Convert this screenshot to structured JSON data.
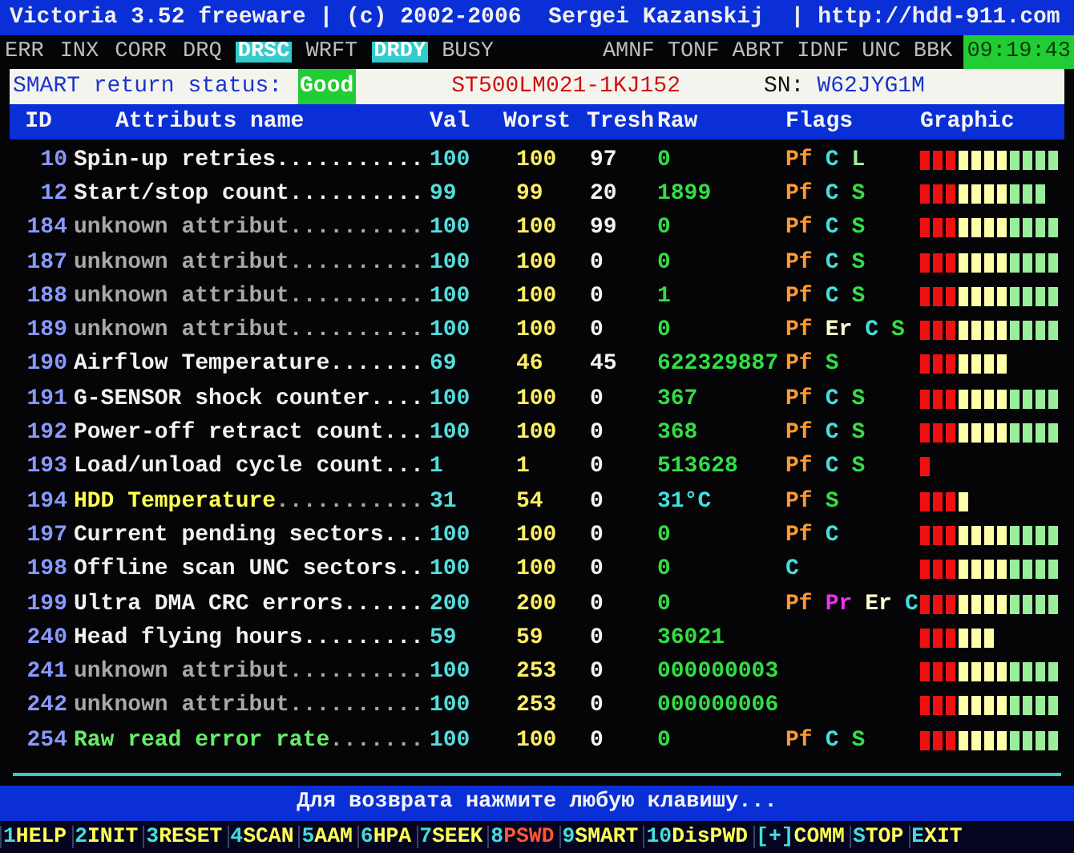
{
  "title_bar": {
    "title": "Victoria 3.52 freeware | (c) 2002-2006  Sergei Kazanskij  | http://hdd-911.com"
  },
  "indicators_left": [
    {
      "label": "ERR",
      "on": false
    },
    {
      "label": "INX",
      "on": false
    },
    {
      "label": "CORR",
      "on": false
    },
    {
      "label": "DRQ",
      "on": false
    },
    {
      "label": "DRSC",
      "on": true
    },
    {
      "label": "WRFT",
      "on": false
    },
    {
      "label": "DRDY",
      "on": true
    },
    {
      "label": "BUSY",
      "on": false
    }
  ],
  "indicators_right": [
    {
      "label": "AMNF",
      "on": false
    },
    {
      "label": "TONF",
      "on": false
    },
    {
      "label": "ABRT",
      "on": false
    },
    {
      "label": "IDNF",
      "on": false
    },
    {
      "label": "UNC",
      "on": false
    },
    {
      "label": "BBK",
      "on": false
    }
  ],
  "clock": "09:19:43",
  "smart_bar": {
    "label": "SMART return status:",
    "status": "Good",
    "model": "ST500LM021-1KJ152",
    "sn_label": "SN:",
    "serial": "W62JYG1M"
  },
  "table": {
    "columns": [
      "ID",
      "Attributs name",
      "Val",
      "Worst",
      "Tresh",
      "Raw",
      "Flags",
      "Graphic"
    ],
    "rows": [
      {
        "id": "10",
        "name": "Spin-up retries...........",
        "kind": "normal",
        "val": "100",
        "worst": "100",
        "tresh": "97",
        "raw": "0",
        "flags": [
          {
            "text": "Pf",
            "kind": "pf"
          },
          {
            "text": "C",
            "kind": "c"
          },
          {
            "text": "L",
            "kind": "l"
          }
        ],
        "segments": [
          {
            "color": "#ee1111"
          },
          {
            "color": "#ee1111"
          },
          {
            "color": "#ee1111"
          },
          {
            "color": "#ffffaa"
          },
          {
            "color": "#ffffaa"
          },
          {
            "color": "#ffffaa"
          },
          {
            "color": "#ffffaa"
          },
          {
            "color": "#99ee99"
          },
          {
            "color": "#99ee99"
          },
          {
            "color": "#99ee99"
          },
          {
            "color": "#99ee99"
          }
        ]
      },
      {
        "id": "12",
        "name": "Start/stop count..........",
        "kind": "normal",
        "val": "99",
        "worst": "99",
        "tresh": "20",
        "raw": "1899",
        "flags": [
          {
            "text": "Pf",
            "kind": "pf"
          },
          {
            "text": "C",
            "kind": "c"
          },
          {
            "text": "S",
            "kind": "s"
          }
        ],
        "segments": [
          {
            "color": "#ee1111"
          },
          {
            "color": "#ee1111"
          },
          {
            "color": "#ee1111"
          },
          {
            "color": "#ffffaa"
          },
          {
            "color": "#ffffaa"
          },
          {
            "color": "#ffffaa"
          },
          {
            "color": "#ffffaa"
          },
          {
            "color": "#99ee99"
          },
          {
            "color": "#99ee99"
          },
          {
            "color": "#99ee99"
          }
        ]
      },
      {
        "id": "184",
        "name": "unknown attribut..........",
        "kind": "unknown",
        "val": "100",
        "worst": "100",
        "tresh": "99",
        "raw": "0",
        "flags": [
          {
            "text": "Pf",
            "kind": "pf"
          },
          {
            "text": "C",
            "kind": "c"
          },
          {
            "text": "S",
            "kind": "s"
          }
        ],
        "segments": [
          {
            "color": "#ee1111"
          },
          {
            "color": "#ee1111"
          },
          {
            "color": "#ee1111"
          },
          {
            "color": "#ffffaa"
          },
          {
            "color": "#ffffaa"
          },
          {
            "color": "#ffffaa"
          },
          {
            "color": "#ffffaa"
          },
          {
            "color": "#99ee99"
          },
          {
            "color": "#99ee99"
          },
          {
            "color": "#99ee99"
          },
          {
            "color": "#99ee99"
          }
        ]
      },
      {
        "id": "187",
        "name": "unknown attribut..........",
        "kind": "unknown",
        "val": "100",
        "worst": "100",
        "tresh": "0",
        "raw": "0",
        "flags": [
          {
            "text": "Pf",
            "kind": "pf"
          },
          {
            "text": "C",
            "kind": "c"
          },
          {
            "text": "S",
            "kind": "s"
          }
        ],
        "segments": [
          {
            "color": "#ee1111"
          },
          {
            "color": "#ee1111"
          },
          {
            "color": "#ee1111"
          },
          {
            "color": "#ffffaa"
          },
          {
            "color": "#ffffaa"
          },
          {
            "color": "#ffffaa"
          },
          {
            "color": "#ffffaa"
          },
          {
            "color": "#99ee99"
          },
          {
            "color": "#99ee99"
          },
          {
            "color": "#99ee99"
          },
          {
            "color": "#99ee99"
          }
        ]
      },
      {
        "id": "188",
        "name": "unknown attribut..........",
        "kind": "unknown",
        "val": "100",
        "worst": "100",
        "tresh": "0",
        "raw": "1",
        "flags": [
          {
            "text": "Pf",
            "kind": "pf"
          },
          {
            "text": "C",
            "kind": "c"
          },
          {
            "text": "S",
            "kind": "s"
          }
        ],
        "segments": [
          {
            "color": "#ee1111"
          },
          {
            "color": "#ee1111"
          },
          {
            "color": "#ee1111"
          },
          {
            "color": "#ffffaa"
          },
          {
            "color": "#ffffaa"
          },
          {
            "color": "#ffffaa"
          },
          {
            "color": "#ffffaa"
          },
          {
            "color": "#99ee99"
          },
          {
            "color": "#99ee99"
          },
          {
            "color": "#99ee99"
          },
          {
            "color": "#99ee99"
          }
        ]
      },
      {
        "id": "189",
        "name": "unknown attribut..........",
        "kind": "unknown",
        "val": "100",
        "worst": "100",
        "tresh": "0",
        "raw": "0",
        "flags": [
          {
            "text": "Pf",
            "kind": "pf"
          },
          {
            "text": "Er",
            "kind": "er"
          },
          {
            "text": "C",
            "kind": "c"
          },
          {
            "text": "S",
            "kind": "s"
          }
        ],
        "segments": [
          {
            "color": "#ee1111"
          },
          {
            "color": "#ee1111"
          },
          {
            "color": "#ee1111"
          },
          {
            "color": "#ffffaa"
          },
          {
            "color": "#ffffaa"
          },
          {
            "color": "#ffffaa"
          },
          {
            "color": "#ffffaa"
          },
          {
            "color": "#99ee99"
          },
          {
            "color": "#99ee99"
          },
          {
            "color": "#99ee99"
          },
          {
            "color": "#99ee99"
          }
        ]
      },
      {
        "id": "190",
        "name": "Airflow Temperature.......",
        "kind": "normal",
        "val": "69",
        "worst": "46",
        "tresh": "45",
        "raw": "622329887",
        "flags": [
          {
            "text": "Pf",
            "kind": "pf"
          },
          {
            "text": "S",
            "kind": "s"
          }
        ],
        "segments": [
          {
            "color": "#ee1111"
          },
          {
            "color": "#ee1111"
          },
          {
            "color": "#ee1111"
          },
          {
            "color": "#ffffaa"
          },
          {
            "color": "#ffffaa"
          },
          {
            "color": "#ffffaa"
          },
          {
            "color": "#ffffaa"
          }
        ]
      },
      {
        "id": "191",
        "name": "G-SENSOR shock counter....",
        "kind": "normal",
        "val": "100",
        "worst": "100",
        "tresh": "0",
        "raw": "367",
        "flags": [
          {
            "text": "Pf",
            "kind": "pf"
          },
          {
            "text": "C",
            "kind": "c"
          },
          {
            "text": "S",
            "kind": "s"
          }
        ],
        "segments": [
          {
            "color": "#ee1111"
          },
          {
            "color": "#ee1111"
          },
          {
            "color": "#ee1111"
          },
          {
            "color": "#ffffaa"
          },
          {
            "color": "#ffffaa"
          },
          {
            "color": "#ffffaa"
          },
          {
            "color": "#ffffaa"
          },
          {
            "color": "#99ee99"
          },
          {
            "color": "#99ee99"
          },
          {
            "color": "#99ee99"
          },
          {
            "color": "#99ee99"
          }
        ]
      },
      {
        "id": "192",
        "name": "Power-off retract count...",
        "kind": "normal",
        "val": "100",
        "worst": "100",
        "tresh": "0",
        "raw": "368",
        "flags": [
          {
            "text": "Pf",
            "kind": "pf"
          },
          {
            "text": "C",
            "kind": "c"
          },
          {
            "text": "S",
            "kind": "s"
          }
        ],
        "segments": [
          {
            "color": "#ee1111"
          },
          {
            "color": "#ee1111"
          },
          {
            "color": "#ee1111"
          },
          {
            "color": "#ffffaa"
          },
          {
            "color": "#ffffaa"
          },
          {
            "color": "#ffffaa"
          },
          {
            "color": "#ffffaa"
          },
          {
            "color": "#99ee99"
          },
          {
            "color": "#99ee99"
          },
          {
            "color": "#99ee99"
          },
          {
            "color": "#99ee99"
          }
        ]
      },
      {
        "id": "193",
        "name": "Load/unload cycle count...",
        "kind": "normal",
        "val": "1",
        "worst": "1",
        "tresh": "0",
        "raw": "513628",
        "flags": [
          {
            "text": "Pf",
            "kind": "pf"
          },
          {
            "text": "C",
            "kind": "c"
          },
          {
            "text": "S",
            "kind": "s"
          }
        ],
        "segments": [
          {
            "color": "#ee1111"
          }
        ]
      },
      {
        "id": "194",
        "name": "HDD Temperature",
        "dots": "...........",
        "kind": "temperature",
        "val": "31",
        "worst": "54",
        "tresh": "0",
        "raw": "31°C",
        "flags": [
          {
            "text": "Pf",
            "kind": "pf"
          },
          {
            "text": "S",
            "kind": "s"
          }
        ],
        "segments": [
          {
            "color": "#ee1111"
          },
          {
            "color": "#ee1111"
          },
          {
            "color": "#ee1111"
          },
          {
            "color": "#ffffaa"
          }
        ]
      },
      {
        "id": "197",
        "name": "Current pending sectors...",
        "kind": "normal",
        "val": "100",
        "worst": "100",
        "tresh": "0",
        "raw": "0",
        "flags": [
          {
            "text": "Pf",
            "kind": "pf"
          },
          {
            "text": "C",
            "kind": "c"
          }
        ],
        "segments": [
          {
            "color": "#ee1111"
          },
          {
            "color": "#ee1111"
          },
          {
            "color": "#ee1111"
          },
          {
            "color": "#ffffaa"
          },
          {
            "color": "#ffffaa"
          },
          {
            "color": "#ffffaa"
          },
          {
            "color": "#ffffaa"
          },
          {
            "color": "#99ee99"
          },
          {
            "color": "#99ee99"
          },
          {
            "color": "#99ee99"
          },
          {
            "color": "#99ee99"
          }
        ]
      },
      {
        "id": "198",
        "name": "Offline scan UNC sectors..",
        "kind": "normal",
        "val": "100",
        "worst": "100",
        "tresh": "0",
        "raw": "0",
        "flags": [
          {
            "text": "C",
            "kind": "c"
          }
        ],
        "segments": [
          {
            "color": "#ee1111"
          },
          {
            "color": "#ee1111"
          },
          {
            "color": "#ee1111"
          },
          {
            "color": "#ffffaa"
          },
          {
            "color": "#ffffaa"
          },
          {
            "color": "#ffffaa"
          },
          {
            "color": "#ffffaa"
          },
          {
            "color": "#99ee99"
          },
          {
            "color": "#99ee99"
          },
          {
            "color": "#99ee99"
          },
          {
            "color": "#99ee99"
          }
        ]
      },
      {
        "id": "199",
        "name": "Ultra DMA CRC errors......",
        "kind": "normal",
        "val": "200",
        "worst": "200",
        "tresh": "0",
        "raw": "0",
        "flags": [
          {
            "text": "Pf",
            "kind": "pf"
          },
          {
            "text": "Pr",
            "kind": "pr"
          },
          {
            "text": "Er",
            "kind": "er"
          },
          {
            "text": "C",
            "kind": "c"
          }
        ],
        "segments": [
          {
            "color": "#ee1111"
          },
          {
            "color": "#ee1111"
          },
          {
            "color": "#ee1111"
          },
          {
            "color": "#ffffaa"
          },
          {
            "color": "#ffffaa"
          },
          {
            "color": "#ffffaa"
          },
          {
            "color": "#ffffaa"
          },
          {
            "color": "#99ee99"
          },
          {
            "color": "#99ee99"
          },
          {
            "color": "#99ee99"
          },
          {
            "color": "#99ee99"
          }
        ]
      },
      {
        "id": "240",
        "name": "Head flying hours.........",
        "kind": "normal",
        "val": "59",
        "worst": "59",
        "tresh": "0",
        "raw": "36021",
        "flags": [],
        "segments": [
          {
            "color": "#ee1111"
          },
          {
            "color": "#ee1111"
          },
          {
            "color": "#ee1111"
          },
          {
            "color": "#ffffaa"
          },
          {
            "color": "#ffffaa"
          },
          {
            "color": "#ffffaa"
          }
        ]
      },
      {
        "id": "241",
        "name": "unknown attribut..........",
        "kind": "unknown",
        "val": "100",
        "worst": "253",
        "tresh": "0",
        "raw": "000000003",
        "flags": [],
        "segments": [
          {
            "color": "#ee1111"
          },
          {
            "color": "#ee1111"
          },
          {
            "color": "#ee1111"
          },
          {
            "color": "#ffffaa"
          },
          {
            "color": "#ffffaa"
          },
          {
            "color": "#ffffaa"
          },
          {
            "color": "#ffffaa"
          },
          {
            "color": "#99ee99"
          },
          {
            "color": "#99ee99"
          },
          {
            "color": "#99ee99"
          },
          {
            "color": "#99ee99"
          }
        ]
      },
      {
        "id": "242",
        "name": "unknown attribut..........",
        "kind": "unknown",
        "val": "100",
        "worst": "253",
        "tresh": "0",
        "raw": "000000006",
        "flags": [],
        "segments": [
          {
            "color": "#ee1111"
          },
          {
            "color": "#ee1111"
          },
          {
            "color": "#ee1111"
          },
          {
            "color": "#ffffaa"
          },
          {
            "color": "#ffffaa"
          },
          {
            "color": "#ffffaa"
          },
          {
            "color": "#ffffaa"
          },
          {
            "color": "#99ee99"
          },
          {
            "color": "#99ee99"
          },
          {
            "color": "#99ee99"
          },
          {
            "color": "#99ee99"
          }
        ]
      },
      {
        "id": "254",
        "name": "Raw read error rate",
        "dots": ".......",
        "kind": "error_rate",
        "val": "100",
        "worst": "100",
        "tresh": "0",
        "raw": "0",
        "flags": [
          {
            "text": "Pf",
            "kind": "pf"
          },
          {
            "text": "C",
            "kind": "c"
          },
          {
            "text": "S",
            "kind": "s"
          }
        ],
        "segments": [
          {
            "color": "#ee1111"
          },
          {
            "color": "#ee1111"
          },
          {
            "color": "#ee1111"
          },
          {
            "color": "#ffffaa"
          },
          {
            "color": "#ffffaa"
          },
          {
            "color": "#ffffaa"
          },
          {
            "color": "#ffffaa"
          },
          {
            "color": "#99ee99"
          },
          {
            "color": "#99ee99"
          },
          {
            "color": "#99ee99"
          },
          {
            "color": "#99ee99"
          }
        ]
      }
    ]
  },
  "message": "Для возврата нажмите любую клавишу...",
  "function_keys": [
    {
      "key": "1",
      "label": "HELP",
      "kind": "normal"
    },
    {
      "key": "2",
      "label": "INIT",
      "kind": "normal"
    },
    {
      "key": "3",
      "label": "RESET",
      "kind": "normal"
    },
    {
      "key": "4",
      "label": "SCAN",
      "kind": "normal"
    },
    {
      "key": "5",
      "label": "AAM",
      "kind": "normal"
    },
    {
      "key": "6",
      "label": "HPA",
      "kind": "normal"
    },
    {
      "key": "7",
      "label": "SEEK",
      "kind": "normal"
    },
    {
      "key": "8",
      "label": "PSWD",
      "kind": "danger"
    },
    {
      "key": "9",
      "label": "SMART",
      "kind": "normal"
    },
    {
      "key": "10",
      "label": "DisPWD",
      "kind": "normal"
    },
    {
      "key": "[+]",
      "label": "COMM",
      "kind": "normal"
    },
    {
      "key": "S",
      "label": "TOP",
      "kind": "normal"
    },
    {
      "key": "E",
      "label": "XIT",
      "kind": "normal"
    }
  ]
}
